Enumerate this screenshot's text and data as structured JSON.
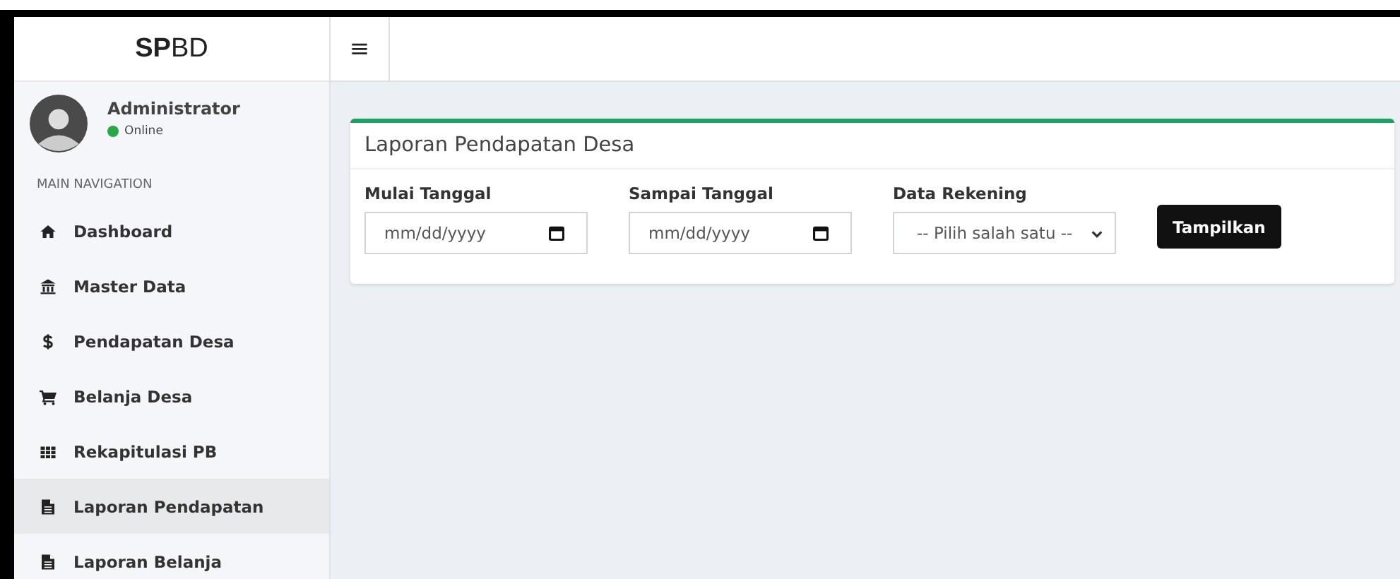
{
  "brand": "**SP**BD",
  "user": {
    "name": "Administrator",
    "status": "Online",
    "color": "#28a745"
  },
  "nav_header": "MAIN NAVIGATION",
  "nav": [
    {
      "label": "Dashboard",
      "kind": "home",
      "selected": false
    },
    {
      "label": "Master Data",
      "kind": "bank",
      "selected": false
    },
    {
      "label": "Pendapatan Desa",
      "kind": "dollar",
      "selected": false
    },
    {
      "label": "Belanja Desa",
      "kind": "cart",
      "selected": false
    },
    {
      "label": "Rekapitulasi PB",
      "kind": "grid",
      "selected": false
    },
    {
      "label": "Laporan Pendapatan",
      "kind": "file",
      "selected": true
    },
    {
      "label": "Laporan Belanja",
      "kind": "file",
      "selected": false
    }
  ],
  "menu_toggle": "≡",
  "card": {
    "title": "Laporan Pendapatan Desa",
    "fields": [
      {
        "kind": "date",
        "label": "Mulai Tanggal",
        "value": "mm/dd/yyyy"
      },
      {
        "kind": "date",
        "label": "Sampai Tanggal",
        "value": "mm/dd/yyyy"
      },
      {
        "kind": "select",
        "label": "Data Rekening",
        "value": "-- Pilih salah satu --"
      }
    ],
    "button": "Tampilkan"
  }
}
